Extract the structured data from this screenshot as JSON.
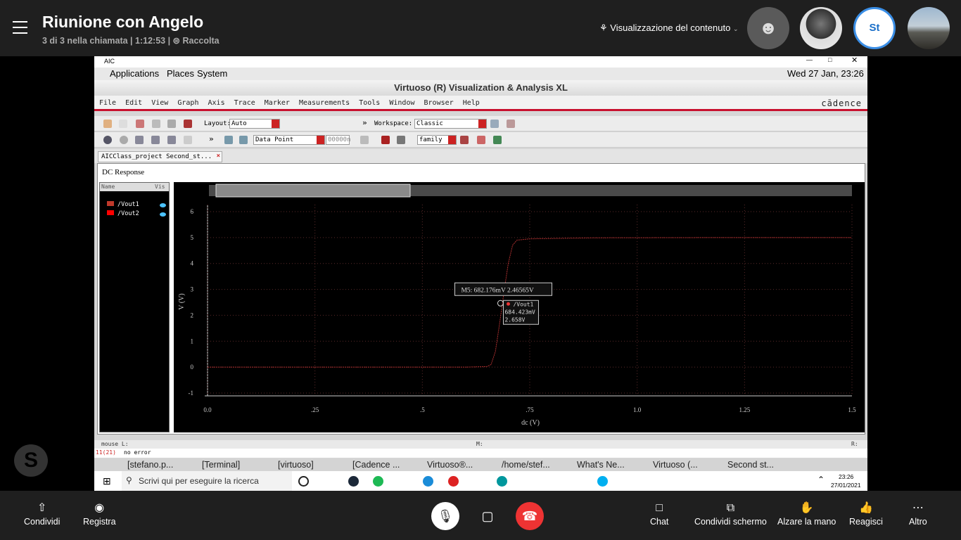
{
  "call": {
    "title": "Riunione con Angelo",
    "subtitle": "3 di 3 nella chiamata | 1:12:53 | ⊜ Raccolta",
    "content_view": "Visualizzazione del contenuto",
    "self_initials": "St"
  },
  "remote": {
    "window_title": "AIC",
    "gnome_menus": [
      "Applications",
      "Places",
      "System"
    ],
    "clock": "Wed 27 Jan, 23:26",
    "app_title": "Virtuoso (R) Visualization & Analysis XL",
    "menus": [
      "File",
      "Edit",
      "View",
      "Graph",
      "Axis",
      "Trace",
      "Marker",
      "Measurements",
      "Tools",
      "Window",
      "Browser",
      "Help"
    ],
    "brand": "cādence",
    "layout_label": "Layout:",
    "layout_value": "Auto",
    "workspace_label": "Workspace:",
    "workspace_value": "Classic",
    "data_point": "Data Point",
    "coord_field": "00000n",
    "family": "family",
    "tab": "AICClass_project Second_st...",
    "graph_title": "DC Response",
    "legend_header_name": "Name",
    "legend_header_vis": "Vis",
    "legend": [
      {
        "name": "/Vout1",
        "color": "#c0392b"
      },
      {
        "name": "/Vout2",
        "color": "#ff0000"
      }
    ],
    "marker_label": "M5: 682.176mV 2.46565V",
    "tooltip": {
      "trace": "/Vout1",
      "x": "684.423mV",
      "y": "2.658V"
    },
    "status_mouse": "mouse L:",
    "status_m": "M:",
    "status_r": "R:",
    "status_num": "11(21)",
    "status_msg": "no error",
    "taskbar": [
      "[stefano.p...",
      "[Terminal]",
      "[virtuoso]",
      "[Cadence ...",
      "Virtuoso®...",
      "/home/stef...",
      "What's Ne...",
      "Virtuoso (...",
      "Second st..."
    ],
    "search_placeholder": "Scrivi qui per eseguire la ricerca",
    "win_time": "23:26",
    "win_date": "27/01/2021"
  },
  "chart_data": {
    "type": "line",
    "title": "DC Response",
    "xlabel": "dc (V)",
    "ylabel": "V (V)",
    "xlim": [
      0,
      1.5
    ],
    "ylim": [
      -1,
      6
    ],
    "xticks": [
      "0.0",
      ".25",
      ".5",
      ".75",
      "1.0",
      "1.25",
      "1.5"
    ],
    "yticks": [
      "-1",
      "0",
      "1",
      "2",
      "3",
      "4",
      "5",
      "6"
    ],
    "series": [
      {
        "name": "/Vout1",
        "x": [
          0,
          0.6,
          0.65,
          0.66,
          0.67,
          0.68,
          0.69,
          0.7,
          0.71,
          0.72,
          0.75,
          0.9,
          1.2,
          1.5
        ],
        "y": [
          0,
          0,
          0.02,
          0.1,
          0.6,
          1.7,
          2.9,
          4.0,
          4.7,
          4.9,
          4.95,
          4.99,
          5,
          5
        ]
      }
    ],
    "marker": {
      "x": 0.682,
      "y": 2.46565
    }
  },
  "bottom": {
    "share": "Condividi",
    "record": "Registra",
    "chat": "Chat",
    "share_screen": "Condividi schermo",
    "raise_hand": "Alzare la mano",
    "react": "Reagisci",
    "more": "Altro"
  }
}
